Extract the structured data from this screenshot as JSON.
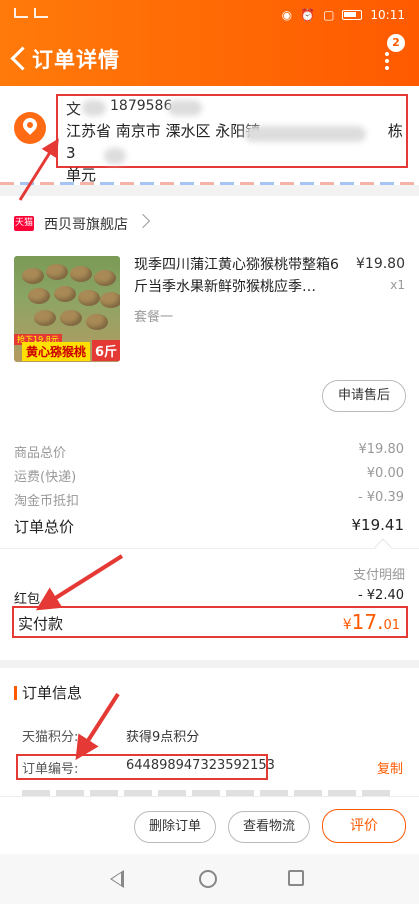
{
  "status_bar": {
    "time": "10:11"
  },
  "header": {
    "title": "订单详情",
    "notification_count": "2"
  },
  "address": {
    "name": "文",
    "phone": "1879586",
    "line": "江苏省 南京市 溧水区 永阳镇",
    "line_tail": "栋3",
    "line2": "单元"
  },
  "store": {
    "logo_text": "天猫",
    "name": "西贝哥旗舰店"
  },
  "product": {
    "title": "现季四川蒲江黄心猕猴桃带整箱6斤当季水果新鲜弥猴桃应季…",
    "sku": "套餐一",
    "price": "¥19.80",
    "qty": "x1",
    "image_tag_price": "抢下19.8元",
    "image_tag_name": "黄心猕猴桃",
    "image_tag_weight": "6斤"
  },
  "buttons": {
    "after_sale": "申请售后",
    "delete_order": "删除订单",
    "track": "查看物流",
    "rate": "评价"
  },
  "summary": {
    "goods_total_label": "商品总价",
    "goods_total": "¥19.80",
    "shipping_label": "运费(快递)",
    "shipping": "¥0.00",
    "coins_label": "淘金币抵扣",
    "coins": "- ¥0.39",
    "order_total_label": "订单总价",
    "order_total": "¥19.41",
    "pay_detail": "支付明细",
    "hongbao_label": "红包",
    "hongbao": "- ¥2.40",
    "paid_label": "实付款",
    "paid_yen": "¥",
    "paid_int": "17.",
    "paid_dec": "01"
  },
  "order_info": {
    "title": "订单信息",
    "points_label": "天猫积分:",
    "points_value": "获得9点积分",
    "number_label": "订单编号:",
    "number_value": "644898947323592153",
    "copy": "复制"
  },
  "colors": {
    "accent": "#ff5a00",
    "highlight": "#e53935"
  }
}
